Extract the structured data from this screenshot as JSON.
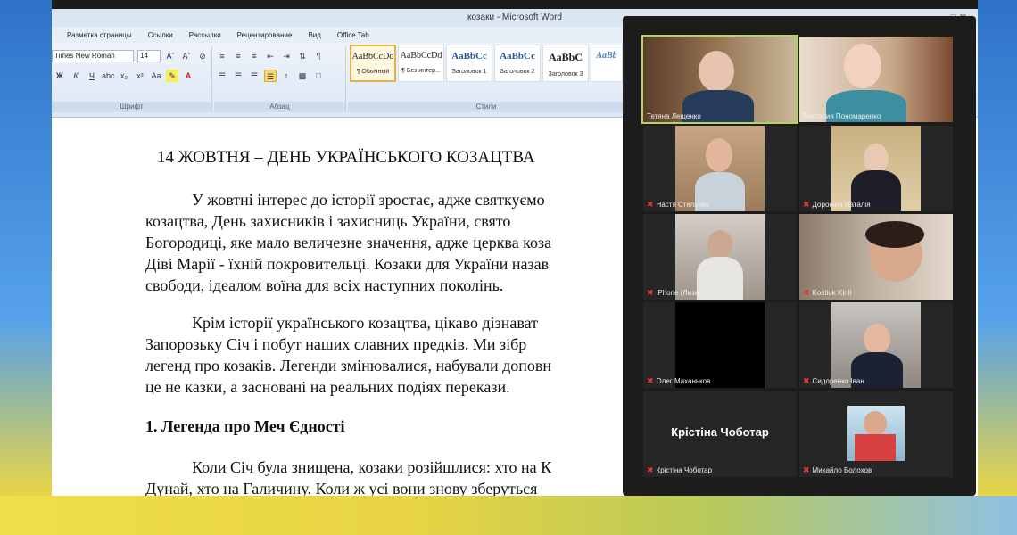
{
  "word": {
    "title": "козаки - Microsoft Word",
    "tabs": [
      "Разметка страницы",
      "Ссылки",
      "Рассылки",
      "Рецензирование",
      "Вид",
      "Office Tab"
    ],
    "font_name": "Times New Roman",
    "font_size": "14",
    "groups": {
      "font": "Шрифт",
      "paragraph": "Абзац",
      "styles": "Стили"
    },
    "styles": [
      {
        "sample": "AaBbCcDd",
        "name": "¶ Обычный"
      },
      {
        "sample": "AaBbCcDd",
        "name": "¶ Без интер..."
      },
      {
        "sample": "AaBbCc",
        "name": "Заголовок 1"
      },
      {
        "sample": "AaBbCc",
        "name": "Заголовок 2"
      },
      {
        "sample": "AaBbC",
        "name": "Заголовок 3"
      },
      {
        "sample": "AaBb",
        "name": ""
      }
    ]
  },
  "document": {
    "title": "14 ЖОВТНЯ – ДЕНЬ УКРАЇНСЬКОГО КОЗАЦТВА",
    "para1": [
      "У жовтні інтерес до історії зростає, адже святкуємо",
      "козацтва, День захисників і захисниць України, свято",
      "Богородиці, яке мало величезне значення, адже церква коза",
      "Діві Марії - їхній покровительці. Козаки для України назав",
      "свободи, ідеалом воїна для всіх наступних поколінь."
    ],
    "para2": [
      "Крім історії українського козацтва, цікаво дізнават",
      "Запорозьку Січ і побут наших славних предків. Ми зібр",
      "легенд про козаків. Легенди змінювалися, набували доповн",
      "це не казки, а засновані на реальних подіях перекази."
    ],
    "heading": "1. Легенда про Меч Єдності",
    "para3": [
      "Коли Січ була знищена, козаки розійшлися: хто на К",
      "Дунай, хто на Галичину. Коли ж усі вони знову зберуться"
    ]
  },
  "zoom": {
    "participants": [
      {
        "name": "Тетяна Лещенко",
        "speaking": true
      },
      {
        "name": "Виктория Пономаренко"
      },
      {
        "name": "Настя Стельник"
      },
      {
        "name": "Дороніна Наталія"
      },
      {
        "name": "iPhone (Лиза)"
      },
      {
        "name": "Kostiuk Kirill"
      },
      {
        "name": "Олег Маханьков"
      },
      {
        "name": "Сидоренко Іван"
      },
      {
        "name": "Крістіна Чоботар",
        "display": "Крістіна Чоботар"
      },
      {
        "name": "Михайло Болохов"
      }
    ]
  }
}
